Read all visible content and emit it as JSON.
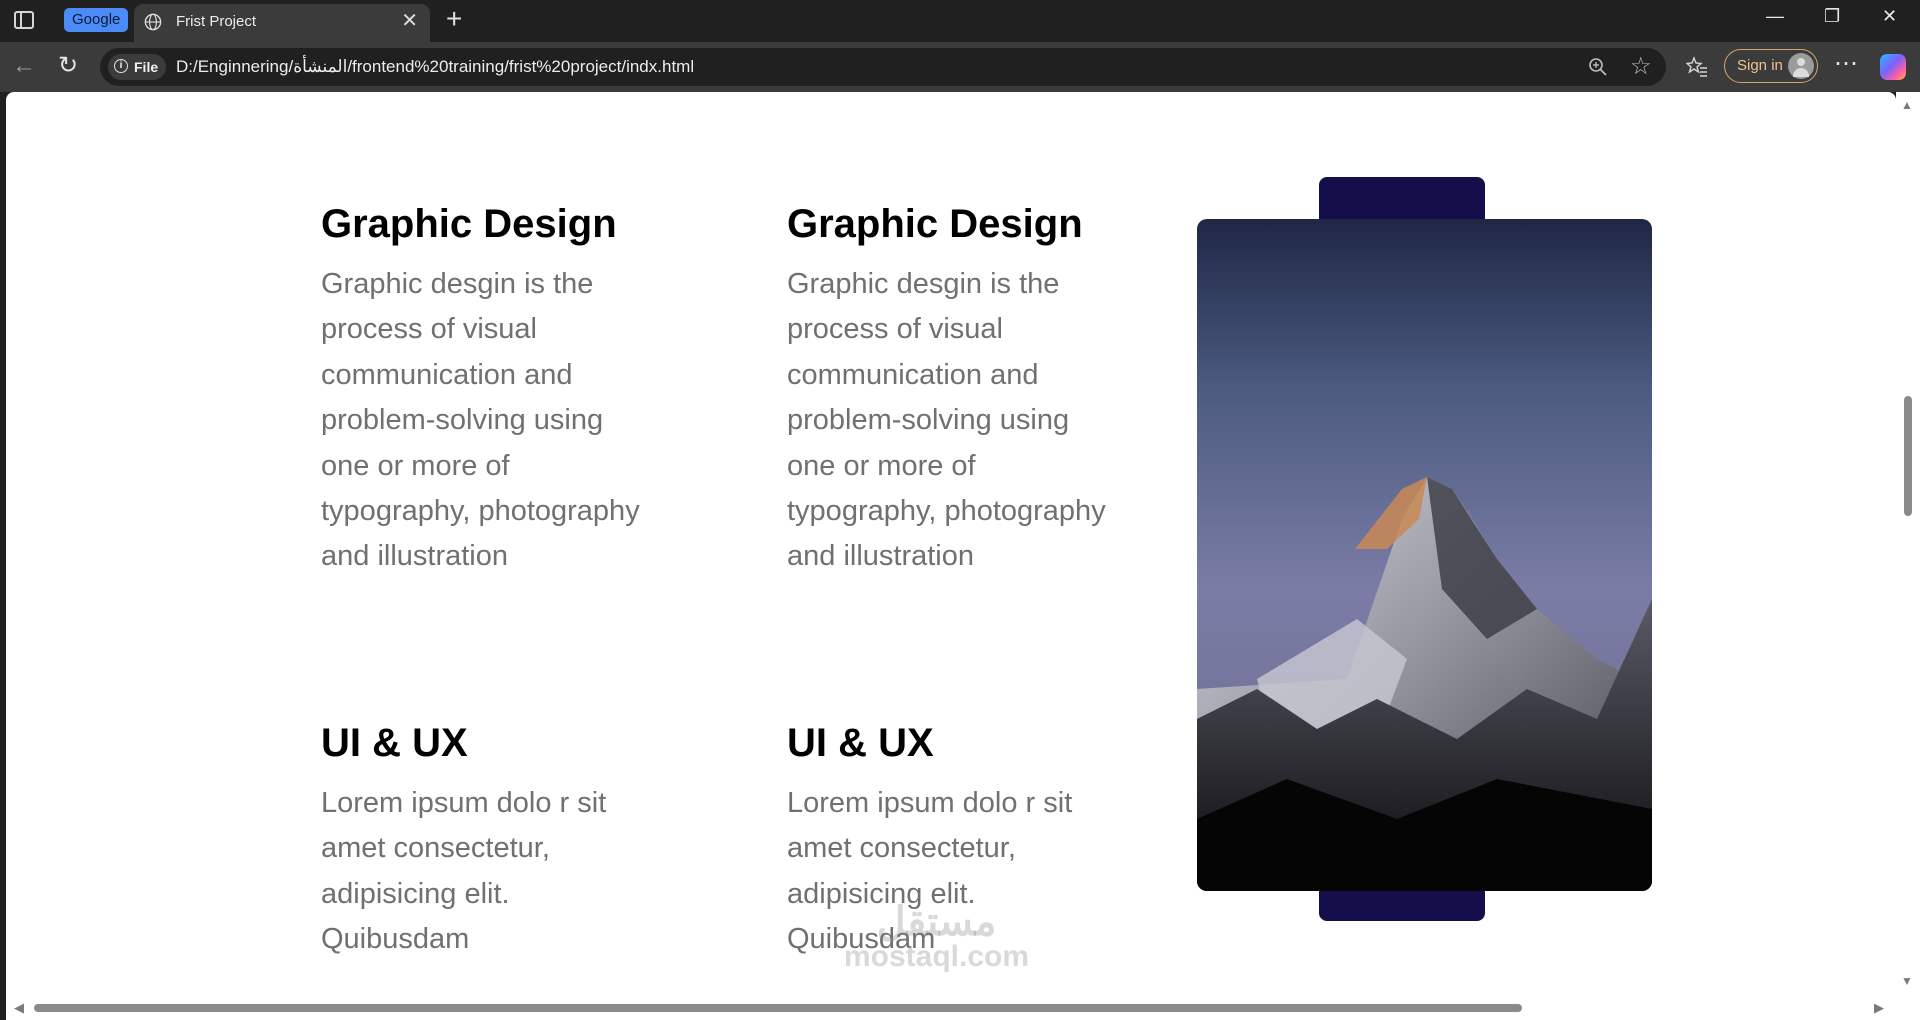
{
  "browser": {
    "sidebar_icon": "sidebar-icon",
    "google_badge": "Google",
    "tab": {
      "title": "Frist Project",
      "icon": "globe-icon",
      "close": "✕"
    },
    "new_tab": "+",
    "window_controls": {
      "minimize": "—",
      "maximize": "❐",
      "close": "✕"
    },
    "back": "←",
    "reload": "↻",
    "file_chip": "File",
    "url": "D:/Enginnering/المنشأة/frontend%20training/frist%20project/indx.html",
    "zoom_icon": "zoom-icon",
    "favorite_star": "☆",
    "favorites_icon": "favorites-icon",
    "sign_in": "Sign in",
    "more": "⋯",
    "copilot_icon": "copilot-icon",
    "colors": {
      "frame": "#202020",
      "toolbar": "#3b3b3b",
      "signin_accent": "#d9a66a"
    }
  },
  "page": {
    "columns": [
      {
        "sections": [
          {
            "heading": "Graphic Design",
            "body": "Graphic desgin is the process of visual communication and problem-solving using one or more of typography, photography and illustration"
          },
          {
            "heading": "UI & UX",
            "body": "Lorem ipsum dolo r sit amet consectetur, adipisicing elit. Quibusdam"
          }
        ]
      },
      {
        "sections": [
          {
            "heading": "Graphic Design",
            "body": "Graphic desgin is the process of visual communication and problem-solving using one or more of typography, photography and illustration"
          },
          {
            "heading": "UI & UX",
            "body": "Lorem ipsum dolo r sit amet consectetur, adipisicing elit. Quibusdam"
          }
        ]
      }
    ],
    "image": {
      "subject": "mountain-photo",
      "accent": "#140f4a"
    },
    "watermark": {
      "arabic": "مستقل",
      "latin": "mostaql.com"
    }
  }
}
